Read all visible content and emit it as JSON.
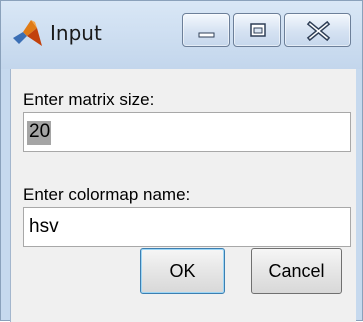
{
  "window": {
    "title": "Input",
    "icon": "matlab-logo-icon"
  },
  "titlebar_buttons": {
    "minimize_icon": "minimize-icon",
    "maximize_icon": "maximize-icon",
    "close_icon": "close-icon"
  },
  "form": {
    "matrix_size": {
      "label": "Enter matrix size:",
      "value": "20"
    },
    "colormap": {
      "label": "Enter colormap name:",
      "value": "hsv"
    }
  },
  "buttons": {
    "ok_label": "OK",
    "cancel_label": "Cancel"
  },
  "colors": {
    "frame": "#c6d9ee",
    "client": "#f0f0f0",
    "ok_border": "#3c7fb1"
  }
}
